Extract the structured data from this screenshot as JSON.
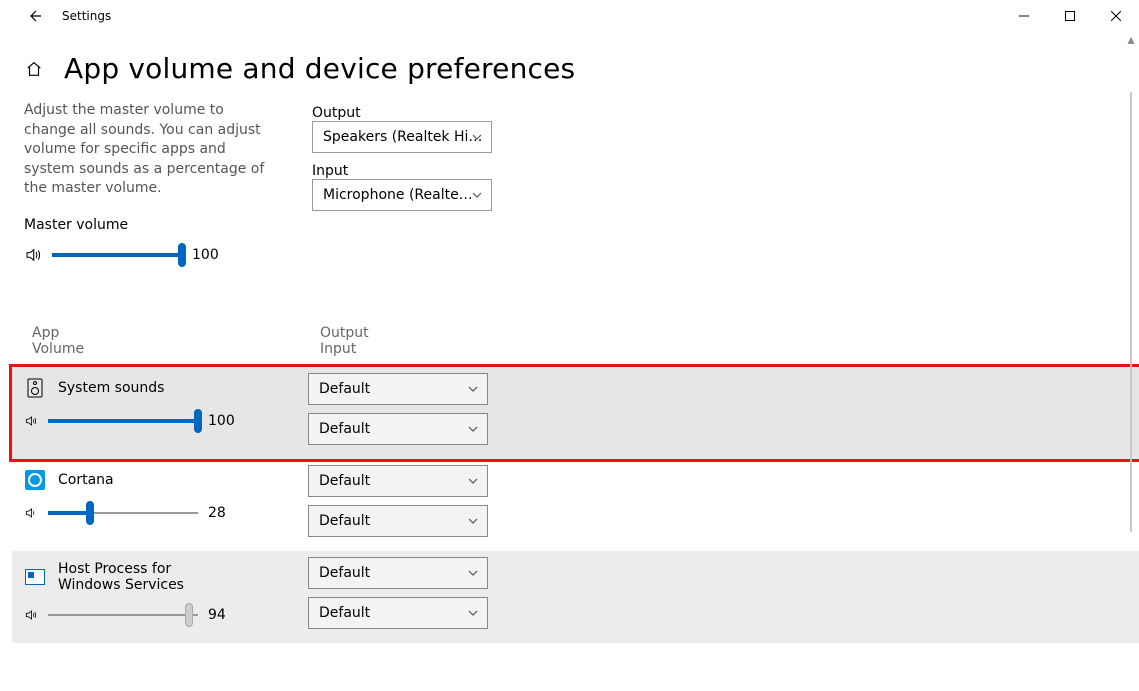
{
  "titlebar": {
    "title": "Settings"
  },
  "header": {
    "title": "App volume and device preferences"
  },
  "description": "Adjust the master volume to change all sounds. You can adjust volume for specific apps and system sounds as a percentage of the master volume.",
  "master": {
    "label": "Master volume",
    "value": 100,
    "value_text": "100"
  },
  "output": {
    "label": "Output",
    "selected": "Speakers (Realtek Hi…"
  },
  "input": {
    "label": "Input",
    "selected": "Microphone (Realte…"
  },
  "apps_header": {
    "col1_line1": "App",
    "col1_line2": "Volume",
    "col2_line1": "Output",
    "col2_line2": "Input"
  },
  "apps": [
    {
      "name": "System sounds",
      "icon": "system-sounds-icon",
      "volume": 100,
      "volume_text": "100",
      "output": "Default",
      "input": "Default",
      "highlight": true
    },
    {
      "name": "Cortana",
      "icon": "cortana-icon",
      "volume": 28,
      "volume_text": "28",
      "output": "Default",
      "input": "Default",
      "highlight": false
    },
    {
      "name": "Host Process for Windows Services",
      "icon": "host-process-icon",
      "volume": 94,
      "volume_text": "94",
      "output": "Default",
      "input": "Default",
      "highlight": false,
      "gray_slider": true,
      "shaded": true
    }
  ]
}
